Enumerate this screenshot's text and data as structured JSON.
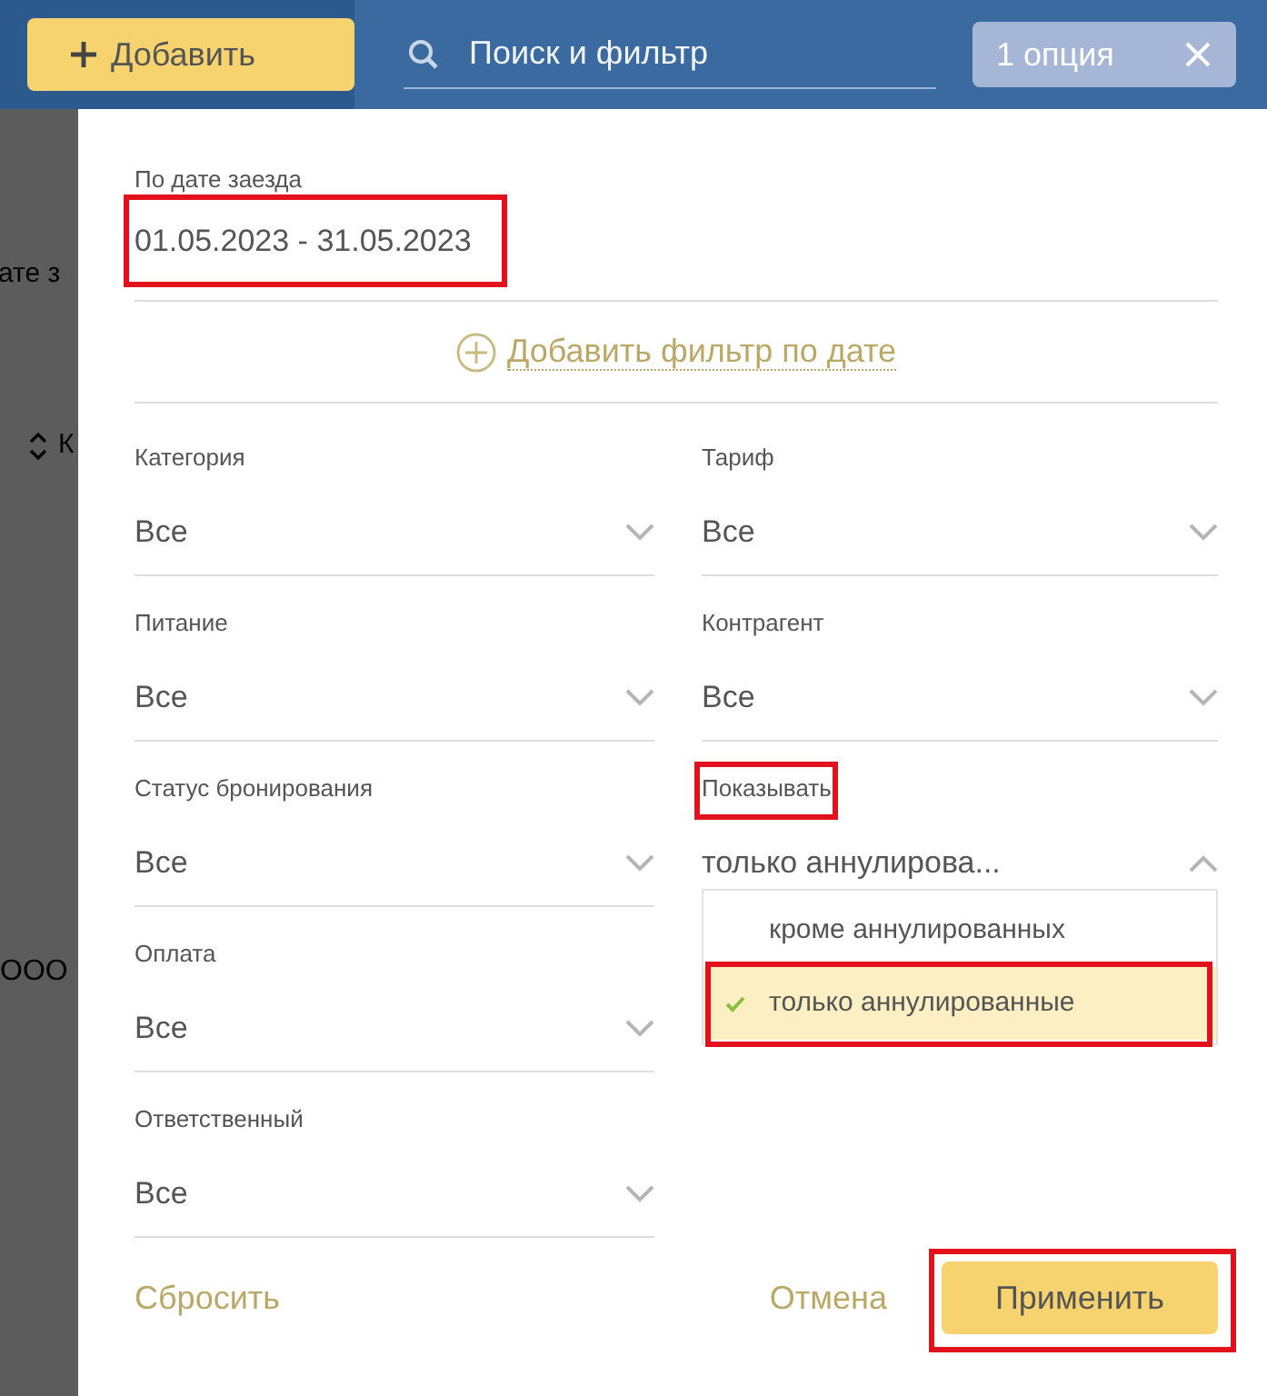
{
  "toolbar": {
    "add_button": "Добавить",
    "search": {
      "placeholder": "Поиск и фильтр"
    },
    "chip": {
      "label": "1 опция"
    }
  },
  "background": {
    "texts": [
      "ате з",
      "К",
      "ООО"
    ]
  },
  "date_filter": {
    "label": "По дате заезда",
    "value": "01.05.2023 - 31.05.2023",
    "highlighted": true
  },
  "add_date_filter": "Добавить фильтр по дате",
  "left_filters": [
    {
      "label": "Категория",
      "value": "Все",
      "highlighted": false,
      "expanded": false
    },
    {
      "label": "Питание",
      "value": "Все",
      "highlighted": false,
      "expanded": false
    },
    {
      "label": "Статус бронирования",
      "value": "Все",
      "highlighted": false,
      "expanded": false
    },
    {
      "label": "Оплата",
      "value": "Все",
      "highlighted": false,
      "expanded": false
    },
    {
      "label": "Ответственный",
      "value": "Все",
      "highlighted": false,
      "expanded": false
    }
  ],
  "right_filters": [
    {
      "label": "Тариф",
      "value": "Все",
      "highlighted": false,
      "expanded": false
    },
    {
      "label": "Контрагент",
      "value": "Все",
      "highlighted": false,
      "expanded": false
    },
    {
      "label": "Показывать",
      "value": "только аннулирова...",
      "highlighted": true,
      "expanded": true,
      "options": [
        {
          "label": "кроме аннулированных",
          "selected": false,
          "highlighted": false
        },
        {
          "label": "только аннулированные",
          "selected": true,
          "highlighted": true
        }
      ]
    }
  ],
  "footer": {
    "reset": "Сбросить",
    "cancel": "Отмена",
    "apply": {
      "label": "Применить",
      "highlighted": true
    }
  }
}
